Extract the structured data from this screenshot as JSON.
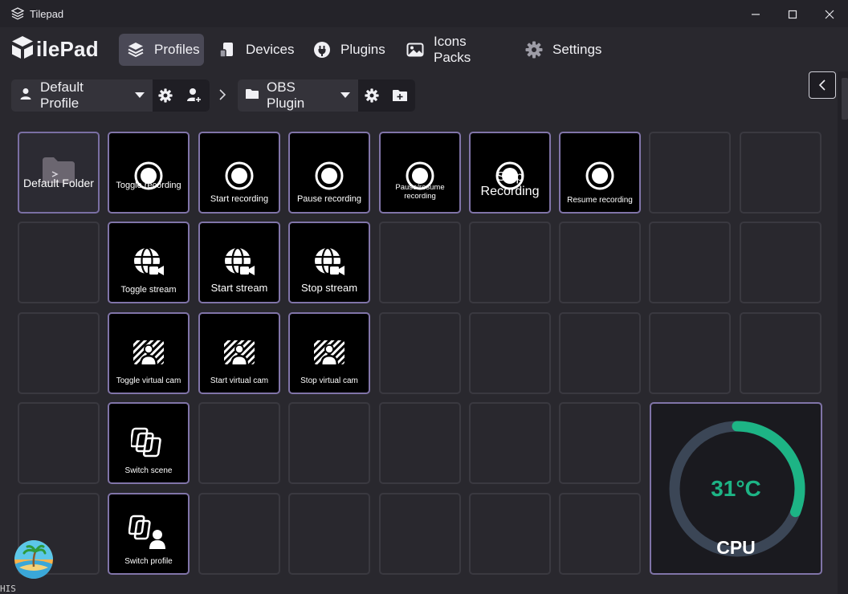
{
  "window": {
    "title": "Tilepad"
  },
  "app": {
    "logo_text": "ilePad"
  },
  "nav": {
    "tabs": [
      {
        "label": "Profiles",
        "icon": "layers-icon",
        "active": true
      },
      {
        "label": "Devices",
        "icon": "devices-icon",
        "active": false
      },
      {
        "label": "Plugins",
        "icon": "plug-icon",
        "active": false
      },
      {
        "label": "Icons Packs",
        "icon": "image-icon",
        "active": false
      },
      {
        "label": "Settings",
        "icon": "gear-icon",
        "active": false
      }
    ]
  },
  "toolbar": {
    "profile": {
      "label": "Default Profile",
      "icon": "user-icon"
    },
    "folder": {
      "label": "OBS Plugin",
      "icon": "folder-icon"
    }
  },
  "tiles": [
    {
      "label": "Default Folder",
      "icon": "folder-icon"
    },
    {
      "label": "Toggle recording",
      "icon": "record-icon"
    },
    {
      "label": "Start recording",
      "icon": "record-icon"
    },
    {
      "label": "Pause recording",
      "icon": "record-icon"
    },
    {
      "label": "Pause/resume recording",
      "icon": "record-icon"
    },
    {
      "label": "Stop Recording",
      "icon": "record-icon"
    },
    {
      "label": "Resume recording",
      "icon": "record-icon"
    },
    {
      "label": "Toggle stream",
      "icon": "globe-camera-icon"
    },
    {
      "label": "Start stream",
      "icon": "globe-camera-icon"
    },
    {
      "label": "Stop stream",
      "icon": "globe-camera-icon"
    },
    {
      "label": "Toggle virtual cam",
      "icon": "virtual-cam-icon"
    },
    {
      "label": "Start virtual cam",
      "icon": "virtual-cam-icon"
    },
    {
      "label": "Stop virtual cam",
      "icon": "virtual-cam-icon"
    },
    {
      "label": "Switch scene",
      "icon": "stacked-squares-icon"
    },
    {
      "label": "Switch profile",
      "icon": "stacked-profile-icon"
    }
  ],
  "cpu_widget": {
    "temperature": "31°C",
    "label": "CPU",
    "gauge_fraction": 0.31,
    "accent": "#1db485",
    "track": "#3b4656"
  },
  "colors": {
    "accent_border": "#8074a8",
    "empty_border": "#3a3940",
    "active_tab": "#4a4956"
  },
  "edge": {
    "bottom_left_text": "HIS"
  }
}
